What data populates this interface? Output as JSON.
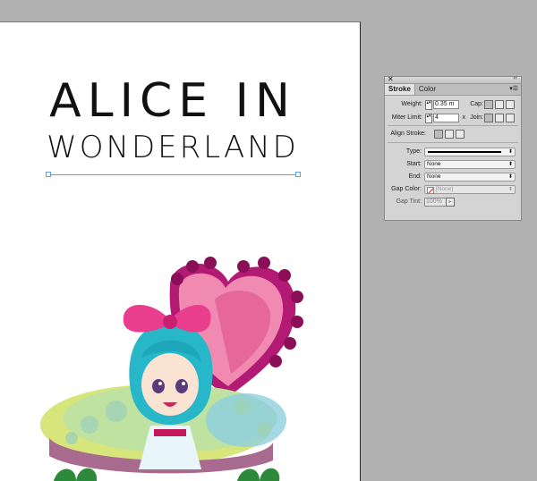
{
  "document": {
    "title_line1": "ALICE IN",
    "title_line2": "WONDERLAND"
  },
  "stroke_panel": {
    "close_glyph": "✕",
    "collapse_glyph": "‹‹",
    "menu_glyph": "▾☰",
    "tabs": [
      {
        "label": "Stroke",
        "active": true
      },
      {
        "label": "Color",
        "active": false
      }
    ],
    "weight_label": "Weight:",
    "weight_value": "0.35 m",
    "cap_label": "Cap:",
    "miter_label": "Miter Limit:",
    "miter_value": "4",
    "miter_unit": "x",
    "join_label": "Join:",
    "align_label": "Align Stroke:",
    "type_label": "Type:",
    "start_label": "Start:",
    "start_value": "None",
    "end_label": "End:",
    "end_value": "None",
    "gap_color_label": "Gap Color:",
    "gap_color_value": "[None]",
    "gap_tint_label": "Gap Tint:",
    "gap_tint_value": "100%"
  },
  "colors": {
    "canvas": "#b1b1b1",
    "page": "#ffffff",
    "selection_guide": "#5aa0e6",
    "panel": "#d4d4d4"
  }
}
